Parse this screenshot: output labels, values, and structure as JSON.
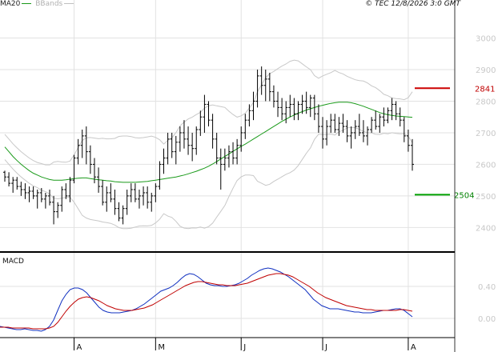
{
  "header": {
    "legend_ma": "MA20",
    "legend_bb": "BBands",
    "credit": "© TEC 12/8/2026 3:0 GMT"
  },
  "colors": {
    "candle": "#000000",
    "ma20": "#1a9a1a",
    "bbands": "#c8c8c8",
    "grid": "#e2e2e2",
    "resistance": "#cc0000",
    "support": "#00a000",
    "macd_line": "#1030c0",
    "signal_line": "#c00000"
  },
  "chart_data": [
    {
      "type": "ohlc",
      "series": [
        {
          "name": "MA20",
          "values": [
            2655,
            2640,
            2625,
            2612,
            2600,
            2590,
            2580,
            2572,
            2566,
            2560,
            2556,
            2552,
            2550,
            2550,
            2550,
            2551,
            2553,
            2555,
            2556,
            2557,
            2557,
            2555,
            2553,
            2551,
            2550,
            2548,
            2547,
            2545,
            2544,
            2543,
            2543,
            2543,
            2543,
            2544,
            2545,
            2546,
            2548,
            2550,
            2552,
            2554,
            2556,
            2558,
            2560,
            2563,
            2566,
            2570,
            2574,
            2578,
            2583,
            2588,
            2594,
            2601,
            2609,
            2617,
            2625,
            2633,
            2641,
            2649,
            2657,
            2664,
            2672,
            2680,
            2688,
            2696,
            2704,
            2712,
            2720,
            2728,
            2736,
            2743,
            2750,
            2756,
            2762,
            2767,
            2772,
            2776,
            2780,
            2784,
            2787,
            2790,
            2793,
            2795,
            2797,
            2797,
            2797,
            2795,
            2792,
            2788,
            2784,
            2779,
            2774,
            2769,
            2764,
            2760,
            2757,
            2755,
            2753,
            2752,
            2751,
            2750,
            2749,
            2749,
            2749,
            2749,
            2749,
            2748,
            2748,
            2747,
            2745,
            2743,
            2741,
            2739,
            2736,
            2733,
            2731,
            2728,
            2726,
            2725,
            2724,
            2723,
            2723,
            2722,
            2722,
            2722,
            2722,
            2723,
            2723,
            2723,
            2723,
            2722,
            2721,
            2720,
            2719
          ]
        },
        {
          "name": "BBands",
          "values": []
        }
      ],
      "candles": [
        [
          2575,
          2580,
          2545,
          2560
        ],
        [
          2560,
          2575,
          2530,
          2540
        ],
        [
          2540,
          2560,
          2510,
          2550
        ],
        [
          2550,
          2560,
          2520,
          2530
        ],
        [
          2530,
          2545,
          2500,
          2520
        ],
        [
          2520,
          2540,
          2490,
          2510
        ],
        [
          2510,
          2530,
          2480,
          2515
        ],
        [
          2515,
          2530,
          2490,
          2500
        ],
        [
          2500,
          2520,
          2460,
          2510
        ],
        [
          2510,
          2525,
          2480,
          2490
        ],
        [
          2490,
          2510,
          2460,
          2500
        ],
        [
          2500,
          2520,
          2470,
          2480
        ],
        [
          2480,
          2500,
          2410,
          2450
        ],
        [
          2450,
          2480,
          2430,
          2470
        ],
        [
          2470,
          2530,
          2450,
          2520
        ],
        [
          2520,
          2540,
          2490,
          2500
        ],
        [
          2500,
          2560,
          2480,
          2550
        ],
        [
          2550,
          2630,
          2540,
          2620
        ],
        [
          2620,
          2680,
          2600,
          2660
        ],
        [
          2660,
          2710,
          2620,
          2690
        ],
        [
          2690,
          2720,
          2600,
          2640
        ],
        [
          2640,
          2660,
          2570,
          2600
        ],
        [
          2600,
          2620,
          2540,
          2560
        ],
        [
          2560,
          2590,
          2510,
          2530
        ],
        [
          2530,
          2550,
          2470,
          2480
        ],
        [
          2480,
          2530,
          2450,
          2510
        ],
        [
          2510,
          2540,
          2480,
          2490
        ],
        [
          2490,
          2520,
          2440,
          2460
        ],
        [
          2460,
          2480,
          2420,
          2430
        ],
        [
          2430,
          2470,
          2410,
          2460
        ],
        [
          2460,
          2520,
          2440,
          2500
        ],
        [
          2500,
          2540,
          2480,
          2520
        ],
        [
          2520,
          2540,
          2480,
          2490
        ],
        [
          2490,
          2520,
          2460,
          2500
        ],
        [
          2500,
          2530,
          2470,
          2510
        ],
        [
          2510,
          2530,
          2460,
          2480
        ],
        [
          2480,
          2510,
          2450,
          2500
        ],
        [
          2500,
          2540,
          2480,
          2530
        ],
        [
          2530,
          2610,
          2520,
          2600
        ],
        [
          2600,
          2650,
          2570,
          2620
        ],
        [
          2620,
          2700,
          2600,
          2680
        ],
        [
          2680,
          2700,
          2620,
          2640
        ],
        [
          2640,
          2690,
          2600,
          2670
        ],
        [
          2670,
          2720,
          2640,
          2700
        ],
        [
          2700,
          2740,
          2650,
          2680
        ],
        [
          2680,
          2720,
          2630,
          2660
        ],
        [
          2660,
          2700,
          2610,
          2650
        ],
        [
          2650,
          2720,
          2630,
          2710
        ],
        [
          2710,
          2770,
          2690,
          2750
        ],
        [
          2750,
          2820,
          2700,
          2790
        ],
        [
          2790,
          2800,
          2720,
          2740
        ],
        [
          2740,
          2760,
          2650,
          2680
        ],
        [
          2680,
          2700,
          2600,
          2620
        ],
        [
          2620,
          2650,
          2520,
          2600
        ],
        [
          2600,
          2650,
          2580,
          2620
        ],
        [
          2620,
          2660,
          2590,
          2640
        ],
        [
          2640,
          2670,
          2600,
          2620
        ],
        [
          2620,
          2680,
          2600,
          2660
        ],
        [
          2660,
          2720,
          2640,
          2700
        ],
        [
          2700,
          2760,
          2680,
          2740
        ],
        [
          2740,
          2790,
          2720,
          2770
        ],
        [
          2770,
          2830,
          2740,
          2800
        ],
        [
          2800,
          2900,
          2780,
          2880
        ],
        [
          2880,
          2910,
          2820,
          2850
        ],
        [
          2850,
          2900,
          2800,
          2870
        ],
        [
          2870,
          2890,
          2800,
          2830
        ],
        [
          2830,
          2850,
          2780,
          2800
        ],
        [
          2800,
          2830,
          2750,
          2780
        ],
        [
          2780,
          2810,
          2740,
          2760
        ],
        [
          2760,
          2800,
          2730,
          2780
        ],
        [
          2780,
          2820,
          2750,
          2790
        ],
        [
          2790,
          2810,
          2740,
          2760
        ],
        [
          2760,
          2800,
          2740,
          2790
        ],
        [
          2790,
          2820,
          2760,
          2800
        ],
        [
          2800,
          2830,
          2760,
          2780
        ],
        [
          2780,
          2820,
          2750,
          2810
        ],
        [
          2810,
          2820,
          2740,
          2760
        ],
        [
          2760,
          2790,
          2700,
          2720
        ],
        [
          2720,
          2750,
          2650,
          2680
        ],
        [
          2680,
          2740,
          2660,
          2720
        ],
        [
          2720,
          2760,
          2700,
          2740
        ],
        [
          2740,
          2760,
          2700,
          2710
        ],
        [
          2710,
          2750,
          2690,
          2730
        ],
        [
          2730,
          2760,
          2700,
          2720
        ],
        [
          2720,
          2740,
          2670,
          2690
        ],
        [
          2690,
          2720,
          2650,
          2700
        ],
        [
          2700,
          2740,
          2680,
          2720
        ],
        [
          2720,
          2760,
          2690,
          2700
        ],
        [
          2700,
          2740,
          2670,
          2690
        ],
        [
          2690,
          2720,
          2660,
          2710
        ],
        [
          2710,
          2750,
          2700,
          2740
        ],
        [
          2740,
          2770,
          2710,
          2720
        ],
        [
          2720,
          2760,
          2700,
          2750
        ],
        [
          2750,
          2780,
          2720,
          2740
        ],
        [
          2740,
          2780,
          2730,
          2770
        ],
        [
          2770,
          2810,
          2740,
          2790
        ],
        [
          2790,
          2800,
          2740,
          2760
        ],
        [
          2760,
          2780,
          2720,
          2740
        ],
        [
          2740,
          2750,
          2670,
          2690
        ],
        [
          2690,
          2710,
          2640,
          2660
        ],
        [
          2660,
          2680,
          2580,
          2600
        ]
      ],
      "resistance": 2841,
      "support": 2504,
      "ylim": [
        2330,
        3090
      ],
      "yticks": [
        2400,
        2500,
        2600,
        2700,
        2800,
        2900,
        3000
      ],
      "ytick_labels": [
        "2400",
        "2500",
        "2600",
        "2700",
        "2800",
        "2900",
        "3000"
      ],
      "xticks": [
        "A",
        "M",
        "J",
        "J",
        "A"
      ]
    },
    {
      "type": "line",
      "title": "MACD",
      "series": [
        {
          "name": "MACD",
          "values": [
            -10,
            -11,
            -12,
            -13,
            -14,
            -14,
            -13,
            -14,
            -15,
            -15,
            -16,
            -14,
            -10,
            -2,
            10,
            22,
            30,
            36,
            38,
            38,
            36,
            32,
            26,
            20,
            14,
            10,
            8,
            7,
            7,
            7,
            8,
            9,
            10,
            12,
            15,
            18,
            22,
            26,
            30,
            34,
            36,
            38,
            41,
            45,
            50,
            54,
            56,
            55,
            52,
            48,
            44,
            42,
            41,
            41,
            40,
            40,
            41,
            42,
            44,
            47,
            50,
            54,
            57,
            60,
            62,
            63,
            62,
            60,
            58,
            55,
            52,
            48,
            44,
            40,
            36,
            30,
            24,
            20,
            16,
            14,
            12,
            12,
            12,
            11,
            10,
            9,
            8,
            8,
            7,
            7,
            7,
            8,
            9,
            10,
            10,
            11,
            12,
            12,
            10,
            6,
            2
          ]
        },
        {
          "name": "Signal",
          "values": [
            -11,
            -11,
            -11,
            -12,
            -12,
            -12,
            -12,
            -12,
            -13,
            -13,
            -13,
            -13,
            -12,
            -10,
            -5,
            2,
            9,
            15,
            20,
            24,
            26,
            27,
            26,
            24,
            22,
            19,
            16,
            14,
            12,
            11,
            10,
            10,
            10,
            11,
            12,
            13,
            15,
            17,
            20,
            23,
            26,
            29,
            32,
            35,
            38,
            41,
            43,
            45,
            46,
            46,
            45,
            44,
            43,
            42,
            42,
            41,
            41,
            41,
            42,
            43,
            44,
            46,
            48,
            50,
            52,
            54,
            55,
            56,
            56,
            55,
            54,
            52,
            49,
            46,
            43,
            40,
            36,
            32,
            29,
            26,
            24,
            22,
            20,
            18,
            16,
            15,
            14,
            13,
            12,
            11,
            11,
            10,
            10,
            10,
            10,
            10,
            10,
            11,
            11,
            10,
            9
          ]
        }
      ],
      "yticks": [
        0,
        40
      ],
      "ytick_labels": [
        "0.00",
        "0.40"
      ],
      "ylim": [
        -20,
        80
      ]
    }
  ]
}
